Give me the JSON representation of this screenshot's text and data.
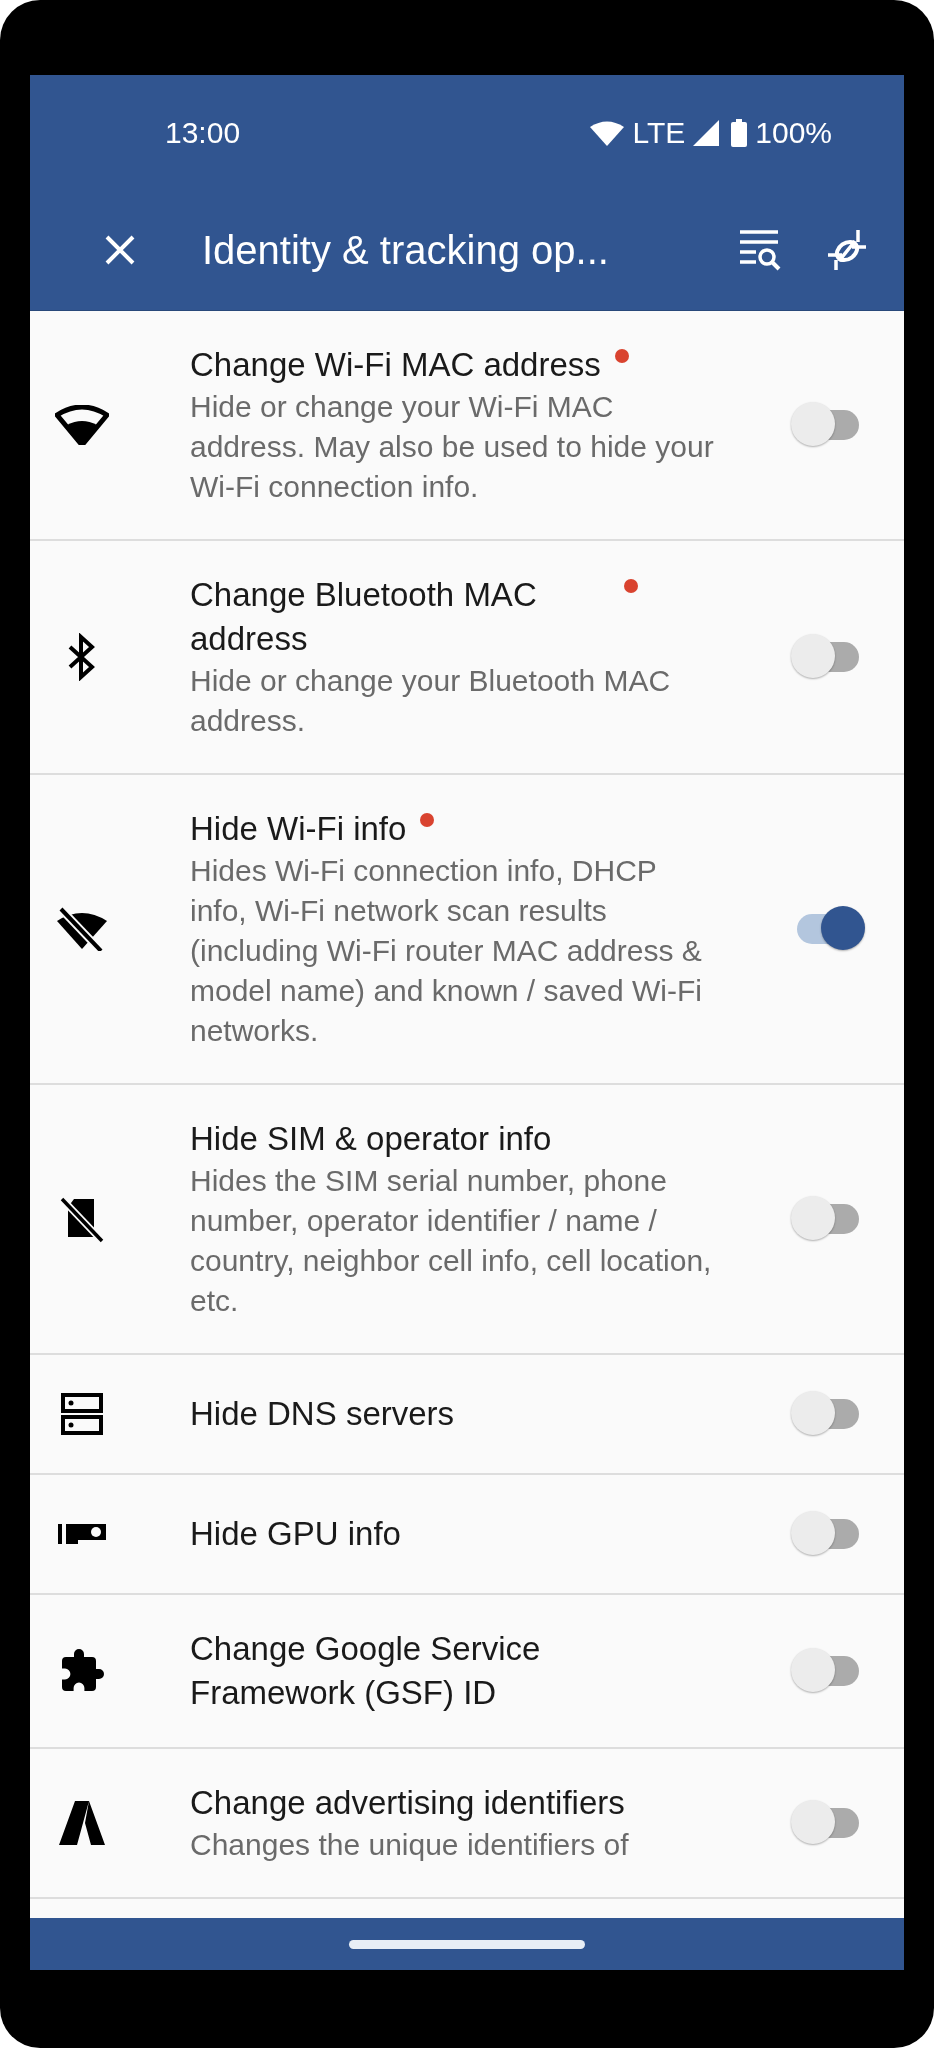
{
  "status_bar": {
    "time": "13:00",
    "network": "LTE",
    "battery": "100%"
  },
  "app_bar": {
    "title": "Identity & tracking op..."
  },
  "settings": [
    {
      "kind": "wifi",
      "title": "Change Wi-Fi MAC address",
      "new_badge": true,
      "description": "Hide or change your Wi-Fi MAC address. May also be used to hide your Wi-Fi connection info.",
      "on": false
    },
    {
      "kind": "bluetooth",
      "title": "Change Bluetooth MAC address",
      "new_badge": true,
      "description": "Hide or change your Bluetooth MAC address.",
      "on": false
    },
    {
      "kind": "wifi-off",
      "title": "Hide Wi-Fi info",
      "new_badge": true,
      "description": "Hides Wi-Fi connection info, DHCP info, Wi-Fi network scan results (including Wi-Fi router MAC address & model name) and known / saved Wi-Fi networks.",
      "on": true
    },
    {
      "kind": "sim-off",
      "title": "Hide SIM & operator info",
      "new_badge": false,
      "description": "Hides the SIM serial number, phone number, operator identifier / name / country, neighbor cell info, cell location, etc.",
      "on": false
    },
    {
      "kind": "dns",
      "title": "Hide DNS servers",
      "new_badge": false,
      "on": false
    },
    {
      "kind": "gpu",
      "title": "Hide GPU info",
      "new_badge": false,
      "on": false
    },
    {
      "kind": "extension",
      "title": "Change Google Service Framework (GSF) ID",
      "new_badge": false,
      "on": false
    },
    {
      "kind": "ads",
      "title": "Change advertising identifiers",
      "new_badge": false,
      "description": "Changes the unique identifiers of",
      "on": false
    }
  ]
}
